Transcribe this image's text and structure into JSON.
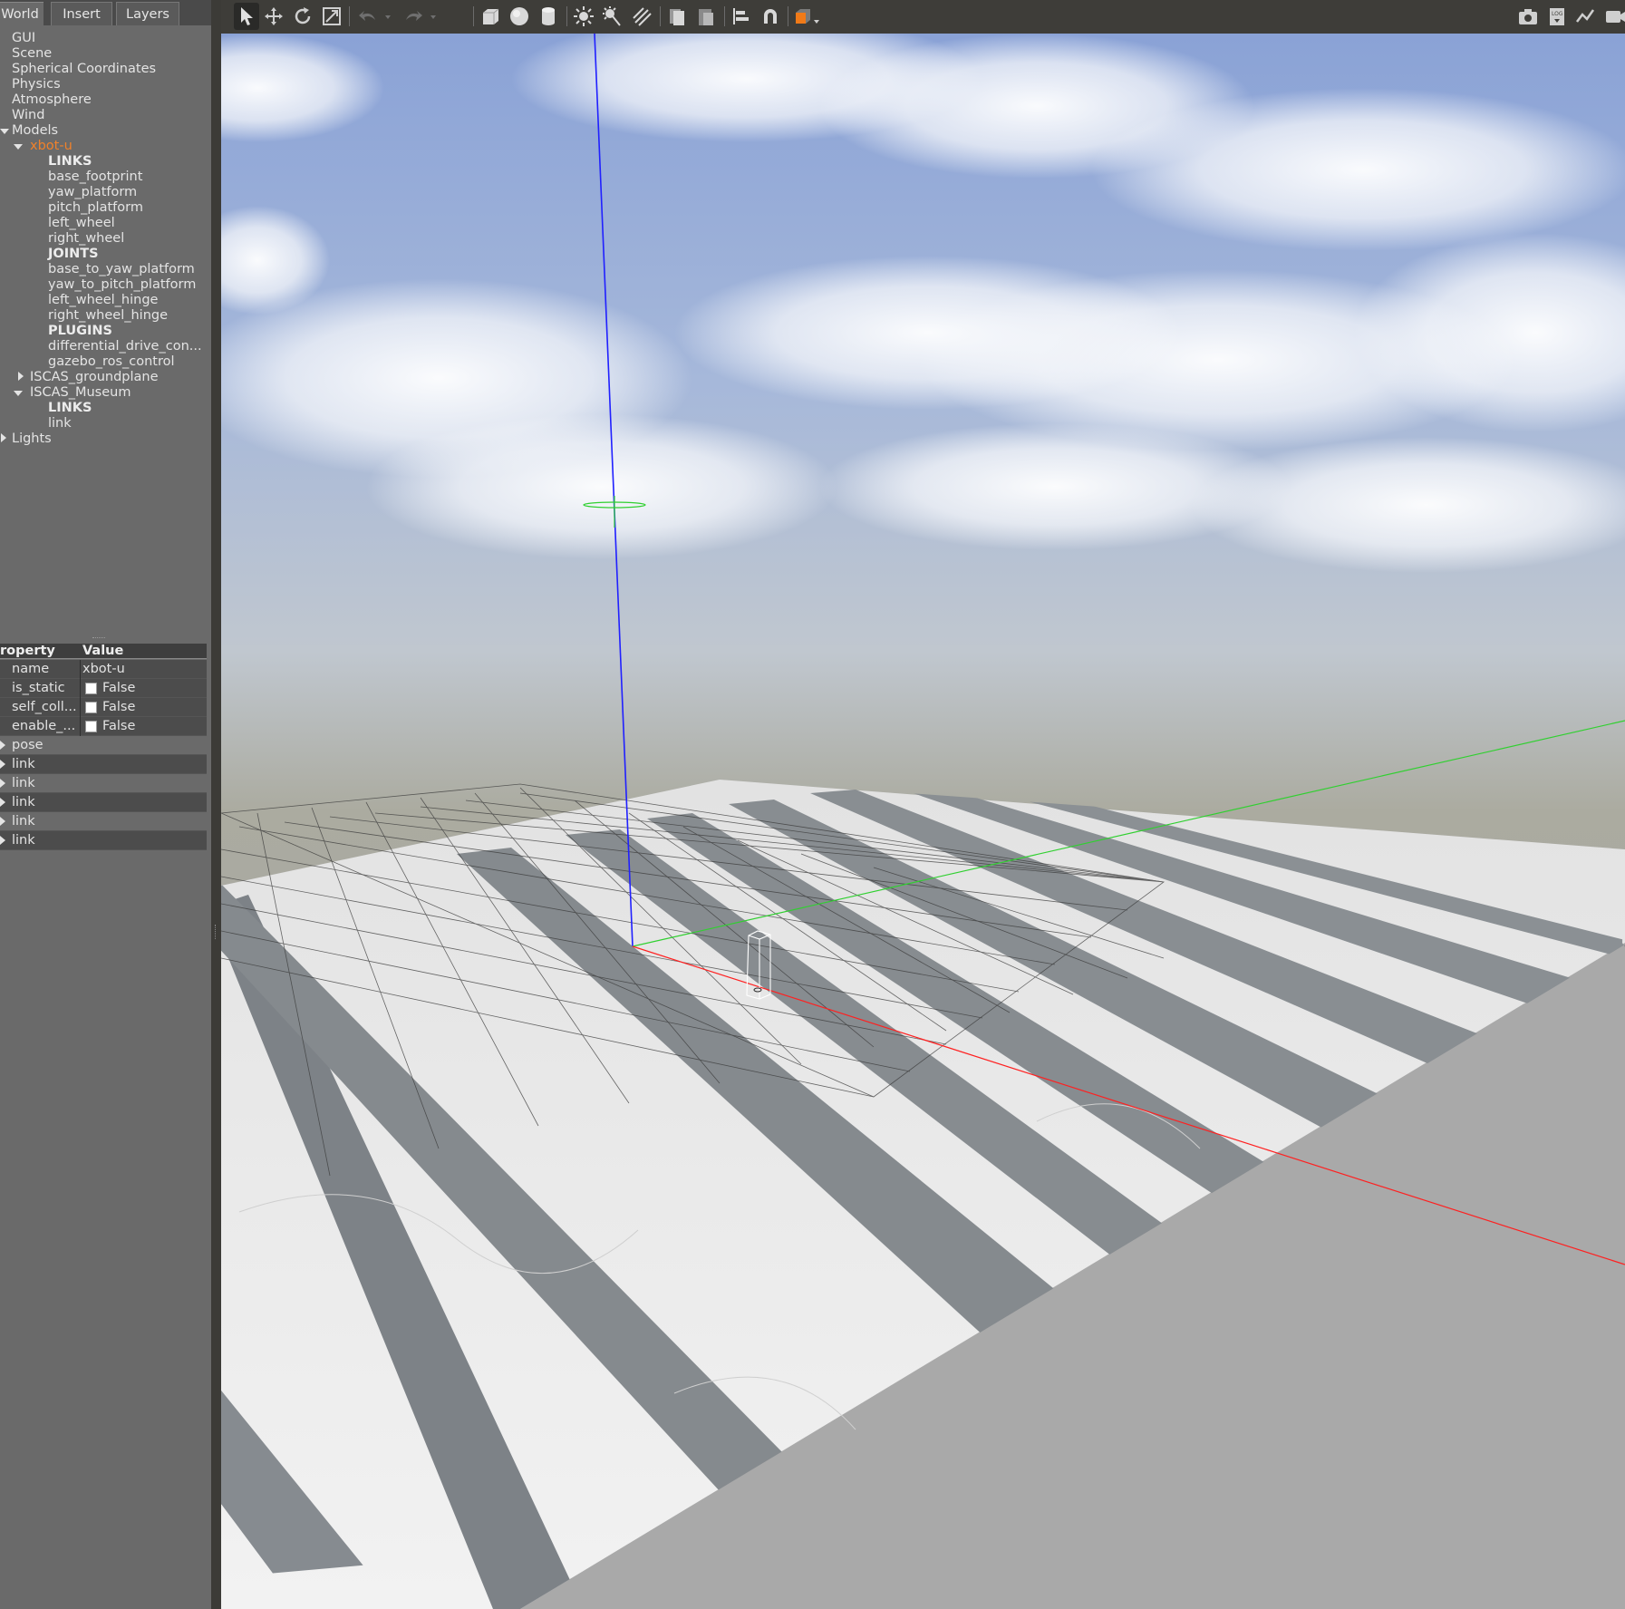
{
  "tabs": [
    {
      "label": "World",
      "active": true
    },
    {
      "label": "Insert",
      "active": false
    },
    {
      "label": "Layers",
      "active": false
    }
  ],
  "tree": {
    "items": [
      {
        "label": "GUI"
      },
      {
        "label": "Scene"
      },
      {
        "label": "Spherical Coordinates"
      },
      {
        "label": "Physics"
      },
      {
        "label": "Atmosphere"
      },
      {
        "label": "Wind"
      },
      {
        "label": "Models",
        "expanded": true
      },
      {
        "label": "xbot-u",
        "expanded": true,
        "selected": true
      },
      {
        "label": "LINKS",
        "section": true
      },
      {
        "label": "base_footprint"
      },
      {
        "label": "yaw_platform"
      },
      {
        "label": "pitch_platform"
      },
      {
        "label": "left_wheel"
      },
      {
        "label": "right_wheel"
      },
      {
        "label": "JOINTS",
        "section": true
      },
      {
        "label": "base_to_yaw_platform"
      },
      {
        "label": "yaw_to_pitch_platform"
      },
      {
        "label": "left_wheel_hinge"
      },
      {
        "label": "right_wheel_hinge"
      },
      {
        "label": "PLUGINS",
        "section": true
      },
      {
        "label": "differential_drive_con..."
      },
      {
        "label": "gazebo_ros_control"
      },
      {
        "label": "ISCAS_groundplane",
        "expanded": false
      },
      {
        "label": "ISCAS_Museum",
        "expanded": true
      },
      {
        "label": "LINKS",
        "section": true
      },
      {
        "label": "link"
      },
      {
        "label": "Lights",
        "expanded": false
      }
    ]
  },
  "properties": {
    "header_property": "roperty",
    "header_value": "Value",
    "rows": [
      {
        "key": "name",
        "value": "xbot-u"
      },
      {
        "key": "is_static",
        "value": "False",
        "checkbox": true
      },
      {
        "key": "self_coll...",
        "value": "False",
        "checkbox": true
      },
      {
        "key": "enable_...",
        "value": "False",
        "checkbox": true
      },
      {
        "key": "pose",
        "expandable": true
      },
      {
        "key": "link",
        "expandable": true
      },
      {
        "key": "link",
        "expandable": true
      },
      {
        "key": "link",
        "expandable": true
      },
      {
        "key": "link",
        "expandable": true
      },
      {
        "key": "link",
        "expandable": true
      }
    ]
  },
  "toolbar": {
    "tools": [
      "select-arrow-icon",
      "translate-icon",
      "rotate-icon",
      "scale-icon",
      "undo-icon",
      "redo-icon",
      "box-icon",
      "sphere-icon",
      "cylinder-icon",
      "point-light-icon",
      "spot-light-icon",
      "directional-light-icon",
      "copy-icon",
      "paste-icon",
      "align-icon",
      "snap-icon",
      "change-view-icon",
      "screenshot-icon",
      "log-icon",
      "plot-icon",
      "record-icon"
    ]
  },
  "colors": {
    "panel_bg": "#6a6a6a",
    "toolbar_bg": "#3e3d39",
    "selected_text": "#f0812a",
    "axis_x": "#ff0000",
    "axis_y": "#00ff00",
    "axis_z": "#0000ff"
  }
}
